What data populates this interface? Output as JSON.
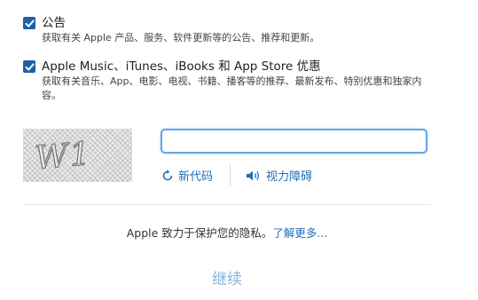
{
  "options": [
    {
      "checked": true,
      "title": "公告",
      "description": "获取有关 Apple 产品、服务、软件更新等的公告、推荐和更新。"
    },
    {
      "checked": true,
      "title": "Apple Music、iTunes、iBooks 和 App Store 优惠",
      "description": "获取有关音乐、App、电影、电视、书籍、播客等的推荐、最新发布、特别优惠和独家内容。"
    }
  ],
  "captcha": {
    "image_text": "W1",
    "input_value": "",
    "new_code_label": "新代码",
    "new_code_icon": "refresh-icon",
    "audio_label": "视力障碍",
    "audio_icon": "speaker-icon"
  },
  "privacy": {
    "text": "Apple 致力于保护您的隐私。",
    "link": "了解更多..."
  },
  "continue_label": "继续",
  "colors": {
    "checkbox": "#1f5fa8",
    "link": "#1d6fb8",
    "continue_disabled": "#88b2dc",
    "input_focus_border": "#6aa6e8"
  }
}
